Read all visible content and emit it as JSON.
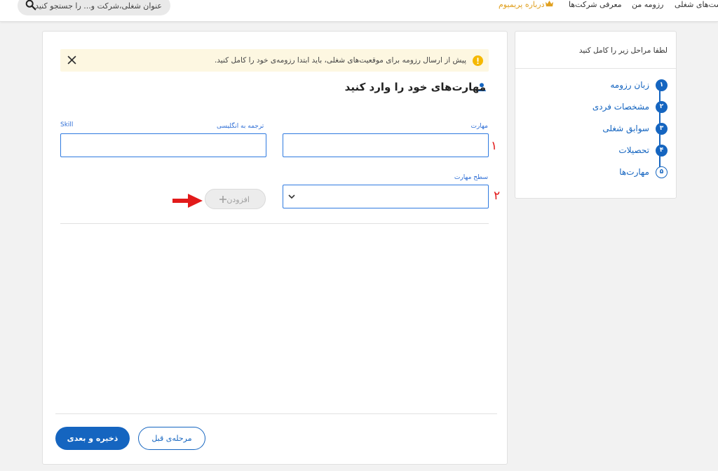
{
  "header": {
    "nav": [
      {
        "label": "ست‌های شغلی"
      },
      {
        "label": "رزومه من"
      },
      {
        "label": "معرفی شرکت‌ها"
      },
      {
        "label": "درباره پریمیوم",
        "color": "#e0a020"
      }
    ],
    "search": {
      "placeholder": "عنوان شغلی،شرکت و... را جستجو کنید"
    }
  },
  "alert": {
    "message": "پیش از ارسال رزومه برای موقعیت‌های شغلی، باید ابتدا رزومه‌ی خود را کامل کنید."
  },
  "form": {
    "title": "مهارت‌های خود را وارد کنید",
    "skill_label": "مهارت",
    "translation_label": "ترجمه به انگلیسی",
    "translation_hint": "Skill",
    "level_label": "سطح مهارت",
    "add_button": "افزودن",
    "annotations": [
      "۱",
      "۲"
    ]
  },
  "footer": {
    "save_next": "ذخیره و بعدی",
    "prev_step": "مرحله‌ی قبل"
  },
  "sidebar": {
    "heading": "لطفا مراحل زیر را کامل کنید",
    "steps": [
      {
        "num": "۱",
        "label": "زبان رزومه"
      },
      {
        "num": "۲",
        "label": "مشخصات فردی"
      },
      {
        "num": "۳",
        "label": "سوابق شغلی"
      },
      {
        "num": "۴",
        "label": "تحصیلات"
      },
      {
        "num": "۵",
        "label": "مهارت‌ها"
      }
    ]
  },
  "colors": {
    "primary": "#1565c0",
    "accent_gold": "#e0a020",
    "alert_bg": "#fdf7e1",
    "annotation_red": "#e21a1a"
  }
}
